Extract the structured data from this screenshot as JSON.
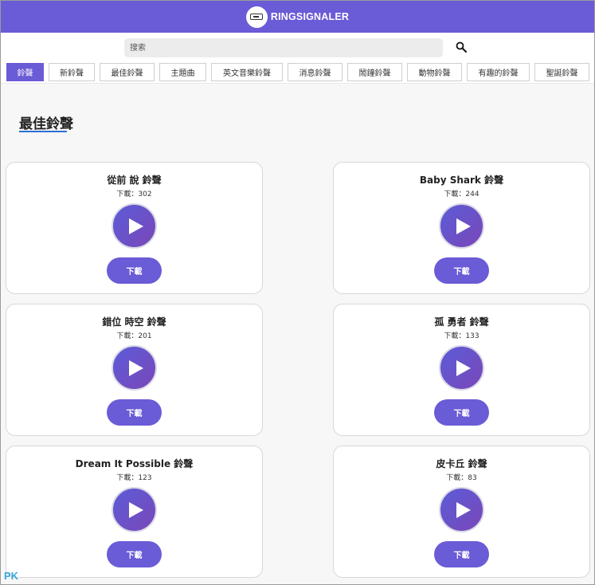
{
  "header": {
    "brand": "RINGSIGNALER"
  },
  "search": {
    "placeholder": "搜索"
  },
  "tabs": [
    {
      "label": "鈴聲",
      "active": true
    },
    {
      "label": "新鈴聲"
    },
    {
      "label": "最佳鈴聲"
    },
    {
      "label": "主題曲"
    },
    {
      "label": "英文音樂鈴聲"
    },
    {
      "label": "消息鈴聲"
    },
    {
      "label": "鬧鐘鈴聲"
    },
    {
      "label": "動物鈴聲"
    },
    {
      "label": "有趣的鈴聲"
    },
    {
      "label": "聖誕鈴聲"
    }
  ],
  "section": {
    "title": "最佳鈴聲"
  },
  "cards": [
    {
      "title": "從前 說 鈴聲",
      "downloads": "下載：302",
      "button": "下載"
    },
    {
      "title": "Baby Shark 鈴聲",
      "downloads": "下載：244",
      "button": "下載"
    },
    {
      "title": "錯位 時空 鈴聲",
      "downloads": "下載：201",
      "button": "下載"
    },
    {
      "title": "孤 勇者 鈴聲",
      "downloads": "下載：133",
      "button": "下載"
    },
    {
      "title": "Dream It Possible 鈴聲",
      "downloads": "下載：123",
      "button": "下載"
    },
    {
      "title": "皮卡丘 鈴聲",
      "downloads": "下載：83",
      "button": "下載"
    }
  ],
  "icons": {
    "search": "search-icon",
    "play": "play-icon",
    "logo": "phone-logo-icon"
  },
  "colors": {
    "accent": "#6a5bd6",
    "underline": "#2a6fd6"
  },
  "watermark": "PK"
}
